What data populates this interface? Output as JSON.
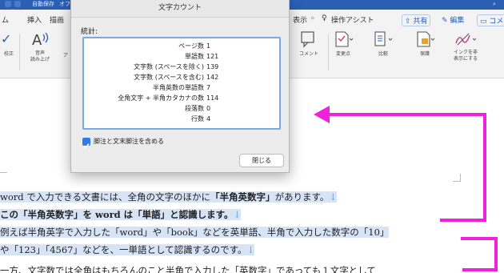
{
  "titlebar": {
    "title": "自動保存",
    "toggle": "オフ"
  },
  "ribbon": {
    "tabs": [
      {
        "label": "ム"
      },
      {
        "label": "挿入"
      },
      {
        "label": "描画"
      },
      {
        "label": "表示"
      },
      {
        "label": "操作アシスト"
      }
    ],
    "share_label": "共有",
    "edit_label": "編集",
    "comment_label": "コメ",
    "buttons": [
      {
        "label": "校正"
      },
      {
        "label": "音声\n読み上げ"
      },
      {
        "label": "ア"
      },
      {
        "label": "コメント"
      },
      {
        "label": "変更点"
      },
      {
        "label": "比較"
      },
      {
        "label": "保護"
      },
      {
        "label": "インクを非\n表示にする"
      }
    ]
  },
  "dialog": {
    "title": "文字カウント",
    "section_label": "統計:",
    "stats": [
      {
        "label": "ページ数",
        "value": "1"
      },
      {
        "label": "単語数",
        "value": "121"
      },
      {
        "label": "文字数 (スペースを除く)",
        "value": "139"
      },
      {
        "label": "文字数 (スペースを含む)",
        "value": "142"
      },
      {
        "label": "半角英数の単語数",
        "value": "7"
      },
      {
        "label": "全角文字 + 半角カタカナの数",
        "value": "114"
      },
      {
        "label": "段落数",
        "value": "0"
      },
      {
        "label": "行数",
        "value": "4"
      }
    ],
    "checkbox_label": "脚注と文末脚注を含める",
    "checkbox_checked": true,
    "close_label": "閉じる"
  },
  "document": {
    "paragraph_mark": "↓",
    "line1": {
      "a": "word で入力できる文書には、全角の文字のほかに",
      "b": "「半角英数字」",
      "c": "があります。"
    },
    "line2": {
      "text": "この「半角英数字」を word は「単語」と認識します。"
    },
    "line3": {
      "text": "例えば半角英字で入力した「word」や「book」などを英単語、半角で入力した数字の「10」"
    },
    "line4": {
      "text": "や「123」「4567」などを、一単語として認識するのです。"
    },
    "line5": {
      "text": "一方、文字数では全角はもちろんのこと半角で入力した「英数字」であっても１文字として"
    }
  },
  "annotation": {
    "color": "#ee22dd"
  }
}
